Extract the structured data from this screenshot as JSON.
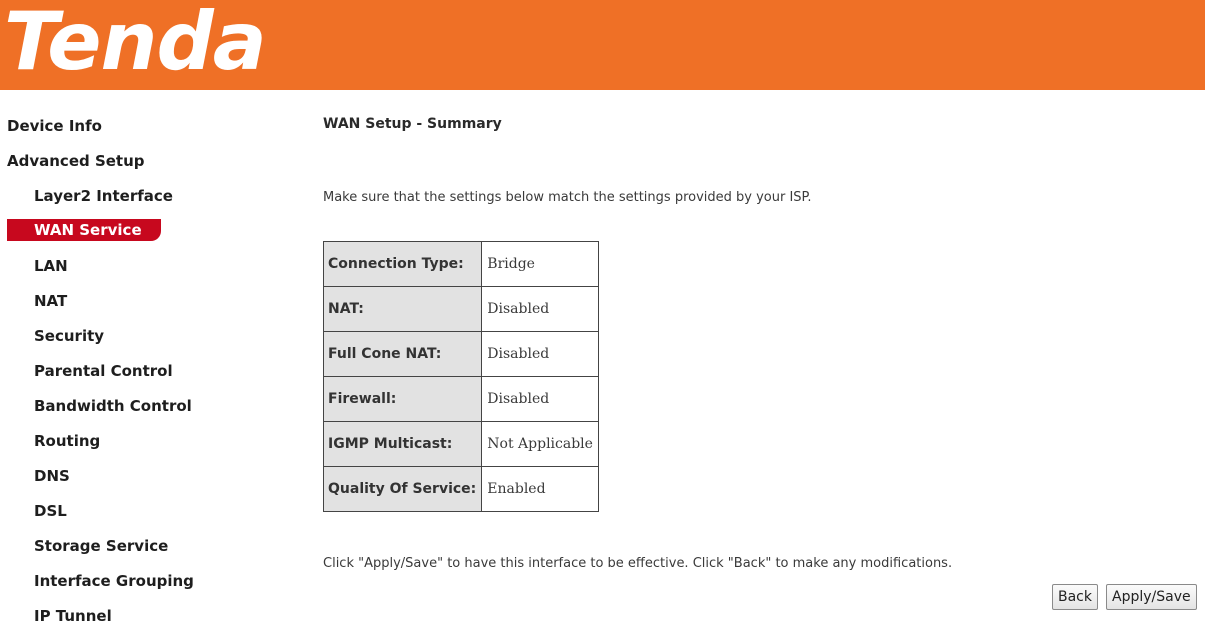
{
  "header": {
    "logo_text": "Tenda",
    "brand_color": "#ef7026"
  },
  "sidebar": {
    "active_color": "#c7081e",
    "items": [
      {
        "label": "Device Info"
      },
      {
        "label": "Advanced Setup"
      },
      {
        "label": "Layer2 Interface"
      },
      {
        "label": "WAN Service"
      },
      {
        "label": "LAN"
      },
      {
        "label": "NAT"
      },
      {
        "label": "Security"
      },
      {
        "label": "Parental Control"
      },
      {
        "label": "Bandwidth Control"
      },
      {
        "label": "Routing"
      },
      {
        "label": "DNS"
      },
      {
        "label": "DSL"
      },
      {
        "label": "Storage Service"
      },
      {
        "label": "Interface Grouping"
      },
      {
        "label": "IP Tunnel"
      }
    ]
  },
  "main": {
    "title": "WAN Setup - Summary",
    "intro": "Make sure that the settings below match the settings provided by your ISP.",
    "summary_rows": [
      {
        "label": "Connection Type:",
        "value": "Bridge"
      },
      {
        "label": "NAT:",
        "value": "Disabled"
      },
      {
        "label": "Full Cone NAT:",
        "value": "Disabled"
      },
      {
        "label": "Firewall:",
        "value": "Disabled"
      },
      {
        "label": "IGMP Multicast:",
        "value": "Not Applicable"
      },
      {
        "label": "Quality Of Service:",
        "value": "Enabled"
      }
    ],
    "note": "Click \"Apply/Save\" to have this interface to be effective. Click \"Back\" to make any modifications.",
    "back_label": "Back",
    "apply_label": "Apply/Save"
  }
}
